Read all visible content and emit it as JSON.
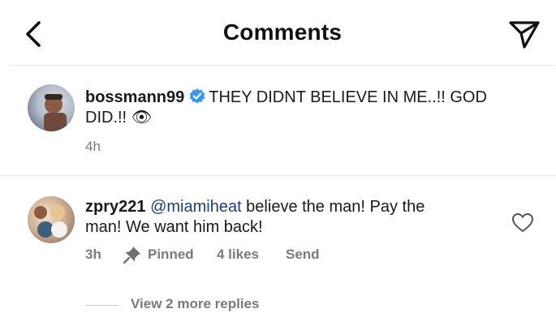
{
  "header": {
    "title": "Comments",
    "back_icon": "chevron-left-icon",
    "send_icon": "paper-plane-icon"
  },
  "caption": {
    "username": "bossmann99",
    "text_line1": "THEY DIDNT BELIEVE IN ME..!! GOD",
    "text_line2": "DID.!!",
    "emoji": "👁",
    "time": "4h",
    "verified_color": "#3897f0"
  },
  "comment": {
    "username": "zpry221",
    "mention": "@miamiheat",
    "text_line1": " believe the man! Pay the",
    "text_line2": "man! We want him back!",
    "time": "3h",
    "pinned_label": "Pinned",
    "likes": "4 likes",
    "send_label": "Send",
    "replies_label": "View 2 more replies"
  },
  "colors": {
    "mention": "#1f3b82",
    "meta_text": "#7a7a7a"
  }
}
